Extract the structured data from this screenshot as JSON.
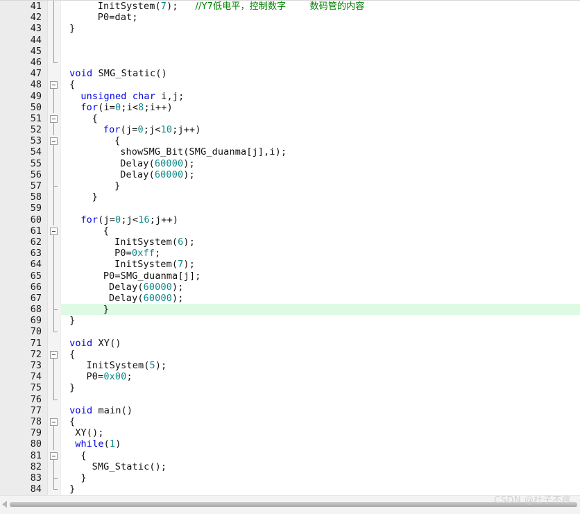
{
  "editor": {
    "language": "C",
    "first_line": 41,
    "last_line": 84,
    "current_line": 68,
    "colors": {
      "keyword": "#0000e6",
      "number": "#0d8a8a",
      "comment": "#008000",
      "text": "#111111",
      "gutter_bg": "#ececec",
      "fold_bg": "#f4f4f4",
      "current_line_bg": "#ddfae3",
      "background": "#ffffff"
    },
    "lines": [
      {
        "n": "41",
        "indent": 6,
        "fold": "vline",
        "tokens": [
          {
            "t": "InitSystem(",
            "c": "txt"
          },
          {
            "t": "7",
            "c": "num"
          },
          {
            "t": ");",
            "c": "txt"
          },
          {
            "t": "   ",
            "c": "txt"
          },
          {
            "t": "//Y7低电平，控制数字        数码管的内容",
            "c": "cmt"
          }
        ]
      },
      {
        "n": "42",
        "indent": 6,
        "fold": "vline",
        "tokens": [
          {
            "t": "P0=dat;",
            "c": "txt"
          }
        ]
      },
      {
        "n": "43",
        "indent": 1,
        "fold": "vline",
        "tokens": [
          {
            "t": "}",
            "c": "txt"
          }
        ]
      },
      {
        "n": "44",
        "indent": 0,
        "fold": "vline",
        "tokens": []
      },
      {
        "n": "45",
        "indent": 0,
        "fold": "vline",
        "tokens": []
      },
      {
        "n": "46",
        "indent": 0,
        "fold": "end",
        "tokens": []
      },
      {
        "n": "47",
        "indent": 1,
        "fold": "none",
        "tokens": [
          {
            "t": "void",
            "c": "kw"
          },
          {
            "t": " SMG_Static()",
            "c": "txt"
          }
        ]
      },
      {
        "n": "48",
        "indent": 1,
        "fold": "box",
        "tokens": [
          {
            "t": "{",
            "c": "txt"
          }
        ]
      },
      {
        "n": "49",
        "indent": 3,
        "fold": "vline",
        "tokens": [
          {
            "t": "unsigned",
            "c": "kw"
          },
          {
            "t": " ",
            "c": "txt"
          },
          {
            "t": "char",
            "c": "kw"
          },
          {
            "t": " i,j;",
            "c": "txt"
          }
        ]
      },
      {
        "n": "50",
        "indent": 3,
        "fold": "vline",
        "tokens": [
          {
            "t": "for",
            "c": "kw"
          },
          {
            "t": "(i=",
            "c": "txt"
          },
          {
            "t": "0",
            "c": "num"
          },
          {
            "t": ";i<",
            "c": "txt"
          },
          {
            "t": "8",
            "c": "num"
          },
          {
            "t": ";i++)",
            "c": "txt"
          }
        ]
      },
      {
        "n": "51",
        "indent": 5,
        "fold": "box",
        "tokens": [
          {
            "t": "{",
            "c": "txt"
          }
        ]
      },
      {
        "n": "52",
        "indent": 7,
        "fold": "vline",
        "tokens": [
          {
            "t": "for",
            "c": "kw"
          },
          {
            "t": "(j=",
            "c": "txt"
          },
          {
            "t": "0",
            "c": "num"
          },
          {
            "t": ";j<",
            "c": "txt"
          },
          {
            "t": "10",
            "c": "num"
          },
          {
            "t": ";j++)",
            "c": "txt"
          }
        ]
      },
      {
        "n": "53",
        "indent": 9,
        "fold": "box",
        "tokens": [
          {
            "t": "{",
            "c": "txt"
          }
        ]
      },
      {
        "n": "54",
        "indent": 10,
        "fold": "vline",
        "tokens": [
          {
            "t": "showSMG_Bit(SMG_duanma[j],i);",
            "c": "txt"
          }
        ]
      },
      {
        "n": "55",
        "indent": 10,
        "fold": "vline",
        "tokens": [
          {
            "t": "Delay(",
            "c": "txt"
          },
          {
            "t": "60000",
            "c": "num"
          },
          {
            "t": ");",
            "c": "txt"
          }
        ]
      },
      {
        "n": "56",
        "indent": 10,
        "fold": "vline",
        "tokens": [
          {
            "t": "Delay(",
            "c": "txt"
          },
          {
            "t": "60000",
            "c": "num"
          },
          {
            "t": ");",
            "c": "txt"
          }
        ]
      },
      {
        "n": "57",
        "indent": 9,
        "fold": "tick",
        "tokens": [
          {
            "t": "}",
            "c": "txt"
          }
        ]
      },
      {
        "n": "58",
        "indent": 5,
        "fold": "vline",
        "tokens": [
          {
            "t": "}",
            "c": "txt"
          }
        ]
      },
      {
        "n": "59",
        "indent": 0,
        "fold": "vline",
        "tokens": []
      },
      {
        "n": "60",
        "indent": 3,
        "fold": "vline",
        "tokens": [
          {
            "t": "for",
            "c": "kw"
          },
          {
            "t": "(j=",
            "c": "txt"
          },
          {
            "t": "0",
            "c": "num"
          },
          {
            "t": ";j<",
            "c": "txt"
          },
          {
            "t": "16",
            "c": "num"
          },
          {
            "t": ";j++)",
            "c": "txt"
          }
        ]
      },
      {
        "n": "61",
        "indent": 7,
        "fold": "box",
        "tokens": [
          {
            "t": "{",
            "c": "txt"
          }
        ]
      },
      {
        "n": "62",
        "indent": 9,
        "fold": "vline",
        "tokens": [
          {
            "t": "InitSystem(",
            "c": "txt"
          },
          {
            "t": "6",
            "c": "num"
          },
          {
            "t": ");",
            "c": "txt"
          }
        ]
      },
      {
        "n": "63",
        "indent": 9,
        "fold": "vline",
        "tokens": [
          {
            "t": "P0=",
            "c": "txt"
          },
          {
            "t": "0xff",
            "c": "num"
          },
          {
            "t": ";",
            "c": "txt"
          }
        ]
      },
      {
        "n": "64",
        "indent": 9,
        "fold": "vline",
        "tokens": [
          {
            "t": "InitSystem(",
            "c": "txt"
          },
          {
            "t": "7",
            "c": "num"
          },
          {
            "t": ");",
            "c": "txt"
          }
        ]
      },
      {
        "n": "65",
        "indent": 7,
        "fold": "vline",
        "tokens": [
          {
            "t": "P0=SMG_duanma[j];",
            "c": "txt"
          }
        ]
      },
      {
        "n": "66",
        "indent": 8,
        "fold": "vline",
        "tokens": [
          {
            "t": "Delay(",
            "c": "txt"
          },
          {
            "t": "60000",
            "c": "num"
          },
          {
            "t": ");",
            "c": "txt"
          }
        ]
      },
      {
        "n": "67",
        "indent": 8,
        "fold": "vline",
        "tokens": [
          {
            "t": "Delay(",
            "c": "txt"
          },
          {
            "t": "60000",
            "c": "num"
          },
          {
            "t": ");",
            "c": "txt"
          }
        ]
      },
      {
        "n": "68",
        "indent": 7,
        "fold": "tick",
        "current": true,
        "tokens": [
          {
            "t": "}",
            "c": "txt"
          }
        ]
      },
      {
        "n": "69",
        "indent": 1,
        "fold": "vline",
        "tokens": [
          {
            "t": "}",
            "c": "txt"
          }
        ]
      },
      {
        "n": "70",
        "indent": 0,
        "fold": "end",
        "tokens": []
      },
      {
        "n": "71",
        "indent": 1,
        "fold": "none",
        "tokens": [
          {
            "t": "void",
            "c": "kw"
          },
          {
            "t": " XY()",
            "c": "txt"
          }
        ]
      },
      {
        "n": "72",
        "indent": 1,
        "fold": "box",
        "tokens": [
          {
            "t": "{",
            "c": "txt"
          }
        ]
      },
      {
        "n": "73",
        "indent": 4,
        "fold": "vline",
        "tokens": [
          {
            "t": "InitSystem(",
            "c": "txt"
          },
          {
            "t": "5",
            "c": "num"
          },
          {
            "t": ");",
            "c": "txt"
          }
        ]
      },
      {
        "n": "74",
        "indent": 4,
        "fold": "vline",
        "tokens": [
          {
            "t": "P0=",
            "c": "txt"
          },
          {
            "t": "0x00",
            "c": "num"
          },
          {
            "t": ";",
            "c": "txt"
          }
        ]
      },
      {
        "n": "75",
        "indent": 1,
        "fold": "vline",
        "tokens": [
          {
            "t": "}",
            "c": "txt"
          }
        ]
      },
      {
        "n": "76",
        "indent": 0,
        "fold": "end",
        "tokens": []
      },
      {
        "n": "77",
        "indent": 1,
        "fold": "none",
        "tokens": [
          {
            "t": "void",
            "c": "kw"
          },
          {
            "t": " main()",
            "c": "txt"
          }
        ]
      },
      {
        "n": "78",
        "indent": 1,
        "fold": "box",
        "tokens": [
          {
            "t": "{",
            "c": "txt"
          }
        ]
      },
      {
        "n": "79",
        "indent": 2,
        "fold": "vline",
        "tokens": [
          {
            "t": "XY();",
            "c": "txt"
          }
        ]
      },
      {
        "n": "80",
        "indent": 2,
        "fold": "vline",
        "tokens": [
          {
            "t": "while",
            "c": "kw"
          },
          {
            "t": "(",
            "c": "txt"
          },
          {
            "t": "1",
            "c": "num"
          },
          {
            "t": ")",
            "c": "txt"
          }
        ]
      },
      {
        "n": "81",
        "indent": 3,
        "fold": "box",
        "tokens": [
          {
            "t": "{",
            "c": "txt"
          }
        ]
      },
      {
        "n": "82",
        "indent": 5,
        "fold": "vline",
        "tokens": [
          {
            "t": "SMG_Static();",
            "c": "txt"
          }
        ]
      },
      {
        "n": "83",
        "indent": 3,
        "fold": "tick",
        "tokens": [
          {
            "t": "}",
            "c": "txt"
          }
        ]
      },
      {
        "n": "84",
        "indent": 1,
        "fold": "end",
        "tokens": [
          {
            "t": "}",
            "c": "txt"
          }
        ]
      }
    ]
  },
  "scrollbar": {
    "orientation": "horizontal",
    "left_arrow_icon": "triangle-left-icon",
    "thumb_position": "full"
  },
  "watermark": {
    "text": "CSDN @杜子不疼."
  }
}
